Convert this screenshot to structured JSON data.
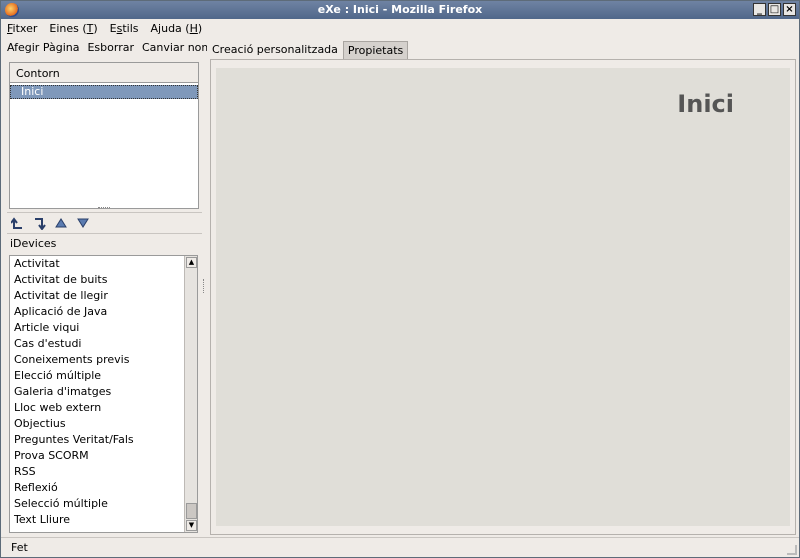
{
  "window": {
    "title": "eXe : Inici - Mozilla Firefox"
  },
  "menubar": {
    "items": [
      {
        "pre": "",
        "u": "F",
        "post": "itxer"
      },
      {
        "pre": "Eines (",
        "u": "T",
        "post": ")"
      },
      {
        "pre": "E",
        "u": "s",
        "post": "tils"
      },
      {
        "pre": "Ajuda (",
        "u": "H",
        "post": ")"
      }
    ]
  },
  "toolbar": {
    "add_page": "Afegir Pàgina",
    "delete": "Esborrar",
    "rename": "Canviar nom"
  },
  "outline": {
    "header": "Contorn",
    "nodes": [
      "Inici"
    ]
  },
  "idevices": {
    "label": "iDevices",
    "items": [
      "Activitat",
      "Activitat de buits",
      "Activitat de llegir",
      "Aplicació de Java",
      "Article viqui",
      "Cas d'estudi",
      "Coneixements previs",
      "Elecció múltiple",
      "Galeria d'imatges",
      "Lloc web extern",
      "Objectius",
      "Preguntes Veritat/Fals",
      "Prova SCORM",
      "RSS",
      "Reflexió",
      "Selecció múltiple",
      "Text Lliure"
    ]
  },
  "tabs": [
    {
      "label": "Creació personalitzada"
    },
    {
      "label": "Propietats"
    }
  ],
  "content": {
    "heading": "Inici"
  },
  "status": {
    "text": "Fet"
  },
  "icons": {
    "promote": "promote-node-icon",
    "demote": "demote-node-icon",
    "up": "move-up-icon",
    "down": "move-down-icon"
  },
  "colors": {
    "title_bar": "#50678a",
    "selection": "#7f98ba"
  }
}
